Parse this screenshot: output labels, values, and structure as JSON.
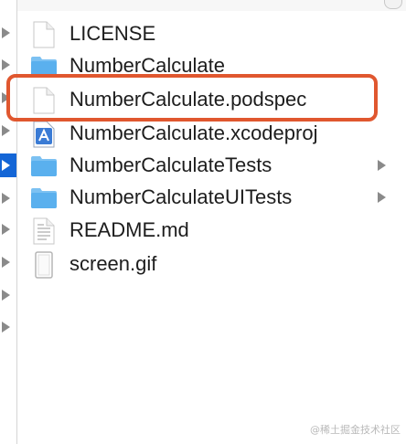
{
  "colors": {
    "selection_blue": "#1466d6",
    "highlight_red": "#e0572f",
    "folder_blue": "#5ab0ee"
  },
  "files": [
    {
      "label": "LICENSE",
      "icon": "document-icon",
      "is_folder": false
    },
    {
      "label": "NumberCalculate",
      "icon": "folder-icon",
      "is_folder": true
    },
    {
      "label": "NumberCalculate.podspec",
      "icon": "document-icon",
      "is_folder": false
    },
    {
      "label": "NumberCalculate.xcodeproj",
      "icon": "xcodeproj-icon",
      "is_folder": false
    },
    {
      "label": "NumberCalculateTests",
      "icon": "folder-icon",
      "is_folder": true
    },
    {
      "label": "NumberCalculateUITests",
      "icon": "folder-icon",
      "is_folder": true
    },
    {
      "label": "README.md",
      "icon": "text-document-icon",
      "is_folder": false
    },
    {
      "label": "screen.gif",
      "icon": "image-file-icon",
      "is_folder": false
    }
  ],
  "watermark": "@稀土掘金技术社区"
}
